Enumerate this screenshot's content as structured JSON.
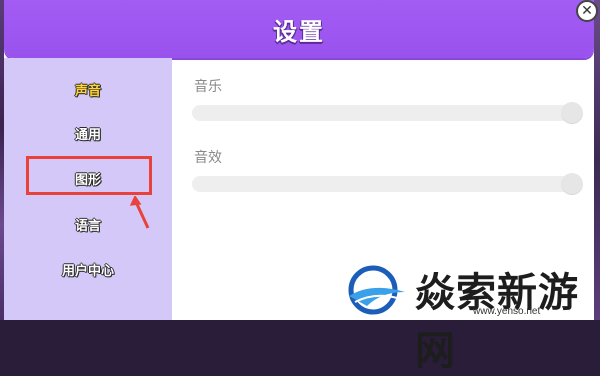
{
  "dialog": {
    "title": "设置",
    "close_icon": "close-icon"
  },
  "sidebar": {
    "items": [
      {
        "label": "声音",
        "active": true
      },
      {
        "label": "通用",
        "active": false
      },
      {
        "label": "图形",
        "active": false
      },
      {
        "label": "语言",
        "active": false
      },
      {
        "label": "用户中心",
        "active": false
      }
    ]
  },
  "settings": {
    "music": {
      "label": "音乐",
      "value": 1.0
    },
    "sfx": {
      "label": "音效",
      "value": 1.0
    }
  },
  "watermark": {
    "text": "焱索新游网",
    "url": "www.yenso.net"
  },
  "colors": {
    "header": "#a25cf3",
    "sidebar": "#d3c8f7",
    "active_label": "#ffd43b",
    "annotation": "#e8423a"
  }
}
